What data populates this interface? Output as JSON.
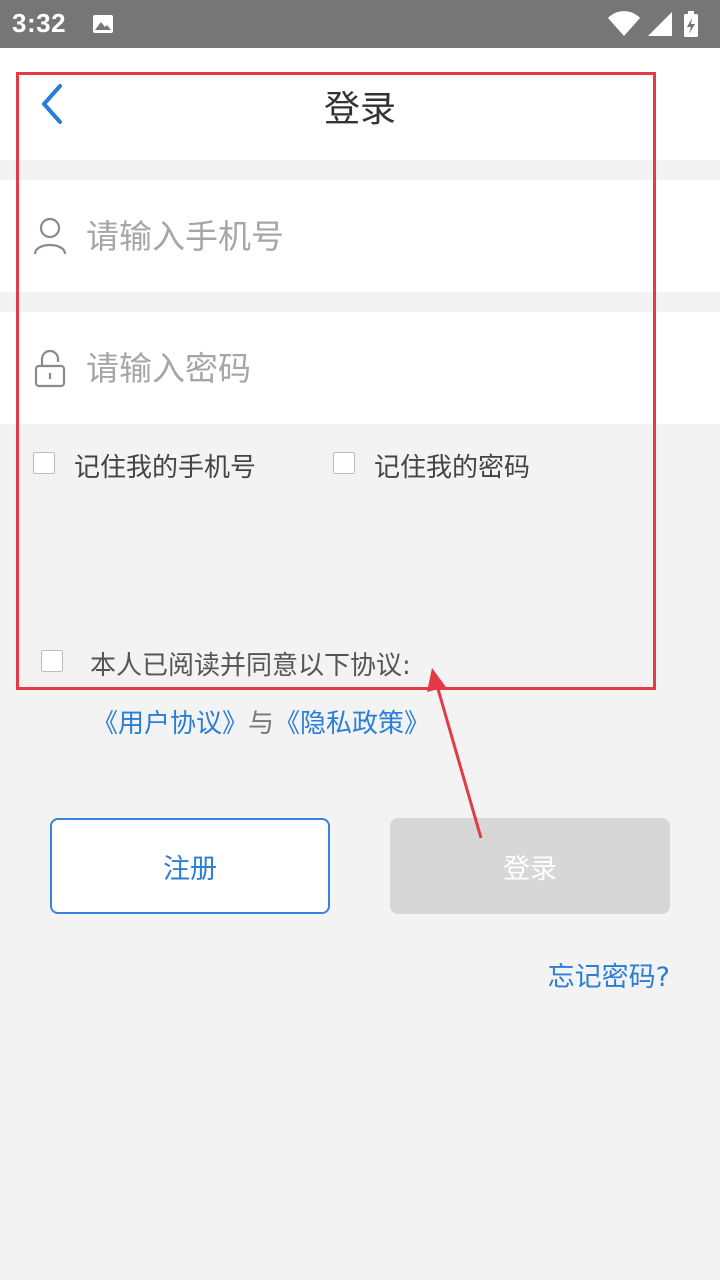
{
  "status_bar": {
    "time": "3:32",
    "icons": [
      "image-icon",
      "wifi-icon",
      "signal-icon",
      "battery-charging-icon"
    ]
  },
  "nav": {
    "title": "登录",
    "back_icon": "chevron-left-icon"
  },
  "form": {
    "phone": {
      "placeholder": "请输入手机号",
      "value": "",
      "icon": "user-icon"
    },
    "password": {
      "placeholder": "请输入密码",
      "value": "",
      "icon": "lock-icon"
    },
    "remember_phone_label": "记住我的手机号",
    "remember_password_label": "记住我的密码"
  },
  "agreement": {
    "text": "本人已阅读并同意以下协议:",
    "user_agreement": "《用户协议》",
    "separator": "与",
    "privacy_policy": "《隐私政策》"
  },
  "buttons": {
    "register": "注册",
    "login": "登录"
  },
  "forgot_password": "忘记密码?",
  "colors": {
    "accent": "#2a7ed8",
    "annotation": "#e23b45",
    "disabled_button": "#d7d7d7",
    "background": "#f3f3f3"
  }
}
